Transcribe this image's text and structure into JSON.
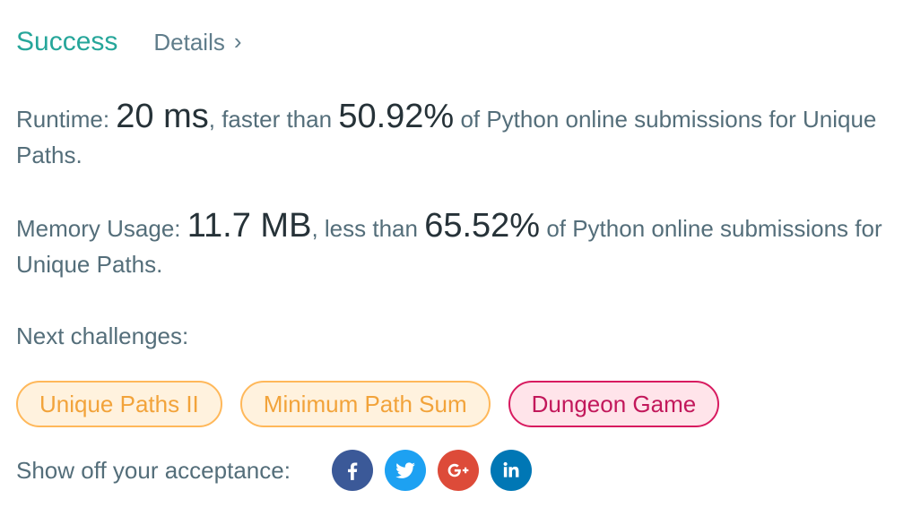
{
  "header": {
    "status": "Success",
    "details_label": "Details"
  },
  "runtime": {
    "label": "Runtime:",
    "value": "20 ms",
    "comparison": ", faster than",
    "percent": "50.92%",
    "suffix": "of Python online submissions for Unique Paths."
  },
  "memory": {
    "label": "Memory Usage:",
    "value": "11.7 MB",
    "comparison": ", less than",
    "percent": "65.52%",
    "suffix": "of Python online submissions for Unique Paths."
  },
  "next": {
    "label": "Next challenges:",
    "chips": [
      {
        "label": "Unique Paths II",
        "difficulty": "medium"
      },
      {
        "label": "Minimum Path Sum",
        "difficulty": "medium"
      },
      {
        "label": "Dungeon Game",
        "difficulty": "hard"
      }
    ]
  },
  "share": {
    "label": "Show off your acceptance:",
    "icons": [
      {
        "name": "facebook-icon",
        "color": "#3b5998"
      },
      {
        "name": "twitter-icon",
        "color": "#1da1f2"
      },
      {
        "name": "google-plus-icon",
        "color": "#dd4b39"
      },
      {
        "name": "linkedin-icon",
        "color": "#0077b5"
      }
    ]
  },
  "colors": {
    "success": "#26a69a",
    "medium": "#f2a33a",
    "hard": "#c2185b"
  }
}
